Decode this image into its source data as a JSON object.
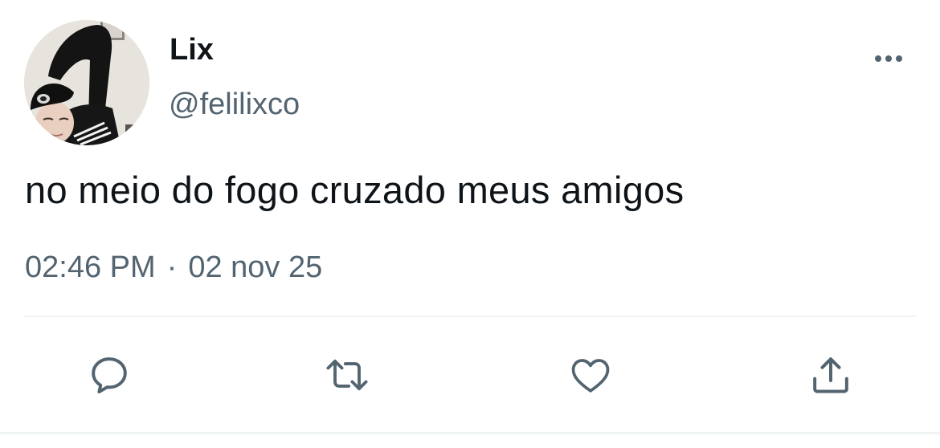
{
  "user": {
    "display_name": "Lix",
    "handle": "@felilixco"
  },
  "tweet": {
    "text": "no meio do fogo cruzado meus amigos",
    "time": "02:46 PM",
    "separator": "·",
    "date": "02 nov 25"
  },
  "icons": {
    "more": "more-horizontal-icon",
    "reply": "reply-icon",
    "retweet": "retweet-icon",
    "like": "heart-icon",
    "share": "share-icon"
  },
  "colors": {
    "text": "#0f1419",
    "secondary": "#536471",
    "divider": "#eff3f4",
    "background": "#ffffff"
  }
}
